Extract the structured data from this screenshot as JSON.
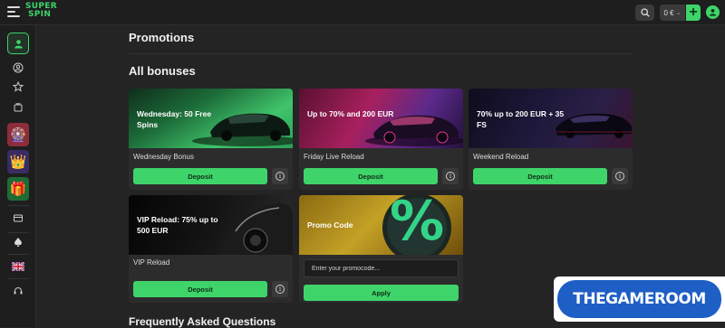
{
  "brand": {
    "logo_line1": "SUPER",
    "logo_line2": "SPIN",
    "accent": "#3fd46a"
  },
  "topbar": {
    "balance": "0 €"
  },
  "page": {
    "title": "Promotions",
    "section_title": "All bonuses",
    "faq_title": "Frequently Asked Questions"
  },
  "bonuses": [
    {
      "banner": "Wednesday: 50 Free Spins",
      "name": "Wednesday Bonus",
      "button": "Deposit"
    },
    {
      "banner": "Up to 70% and 200 EUR",
      "name": "Friday Live Reload",
      "button": "Deposit"
    },
    {
      "banner": "70% up to 200 EUR + 35 FS",
      "name": "Weekend Reload",
      "button": "Deposit"
    },
    {
      "banner": "VIP Reload: 75% up to 500 EUR",
      "name": "VIP Reload",
      "button": "Deposit"
    }
  ],
  "promo": {
    "banner": "Promo Code",
    "placeholder": "Enter your promocode...",
    "button": "Apply",
    "symbol": "%"
  },
  "watermark": {
    "text": "THEGAMEROOM"
  }
}
